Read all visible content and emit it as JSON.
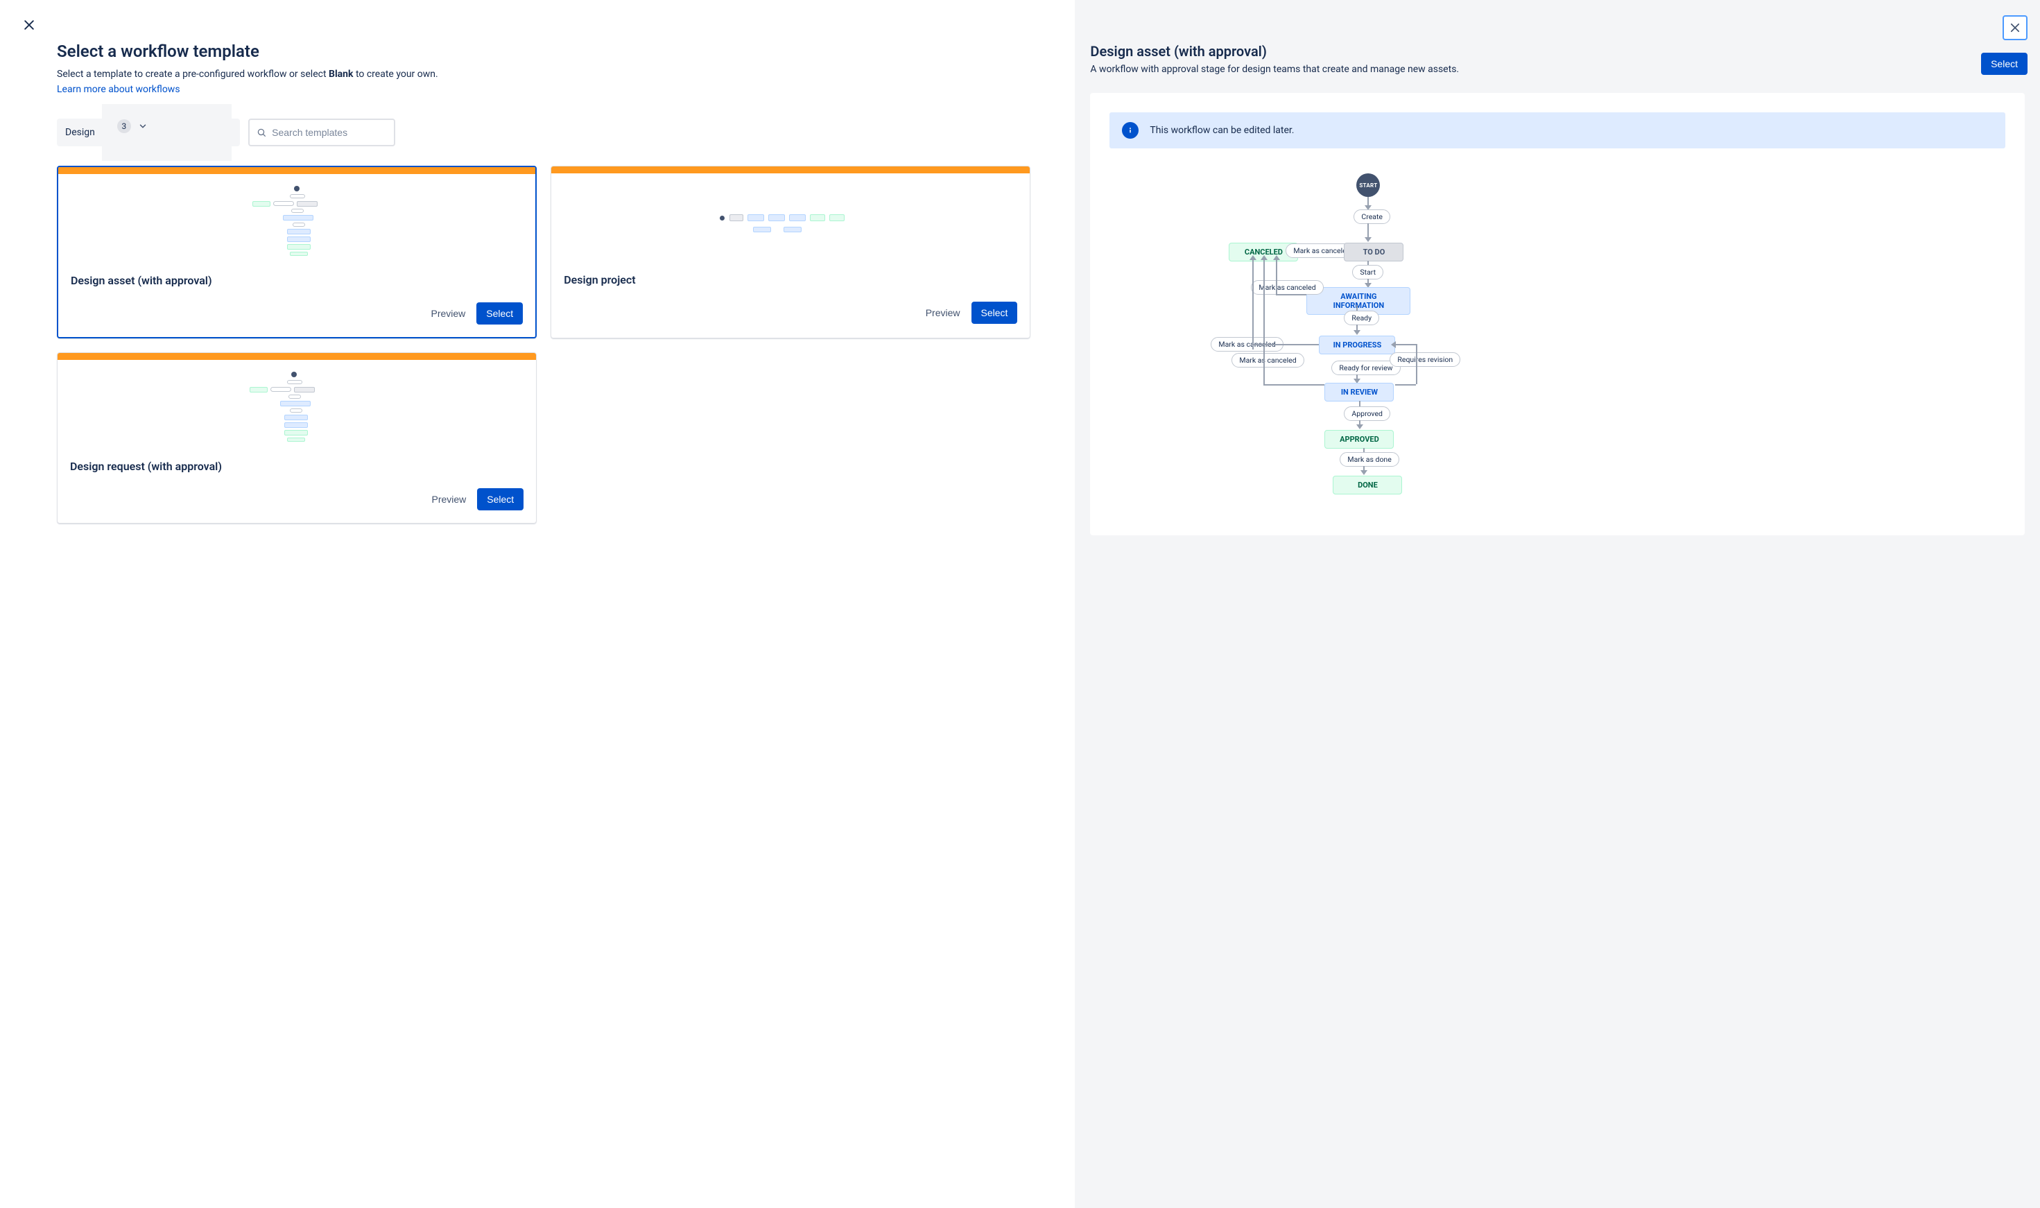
{
  "left": {
    "title": "Select a workflow template",
    "description_prefix": "Select a template to create a pre-configured workflow or select ",
    "description_bold": "Blank",
    "description_suffix": " to create your own.",
    "learn_more": "Learn more about workflows",
    "filter_label": "Design",
    "filter_count": "3",
    "search_placeholder": "Search templates"
  },
  "cards": [
    {
      "title": "Design asset (with approval)",
      "preview": "Preview",
      "select": "Select",
      "selected": true
    },
    {
      "title": "Design project",
      "preview": "Preview",
      "select": "Select",
      "selected": false
    },
    {
      "title": "Design request (with approval)",
      "preview": "Preview",
      "select": "Select",
      "selected": false
    }
  ],
  "right": {
    "title": "Design asset (with approval)",
    "select": "Select",
    "description": "A workflow with approval stage for design teams that create and manage new assets.",
    "banner": "This workflow can be edited later."
  },
  "workflow": {
    "start": "START",
    "statuses": {
      "canceled": "CANCELED",
      "todo": "TO DO",
      "awaiting": "AWAITING INFORMATION",
      "inprogress": "IN PROGRESS",
      "inreview": "IN REVIEW",
      "approved": "APPROVED",
      "done": "DONE"
    },
    "transitions": {
      "create": "Create",
      "mark_canceled": "Mark as canceled",
      "start": "Start",
      "ready": "Ready",
      "ready_for_review": "Ready for review",
      "requires_revision": "Requires revision",
      "approved": "Approved",
      "mark_done": "Mark as done"
    }
  }
}
